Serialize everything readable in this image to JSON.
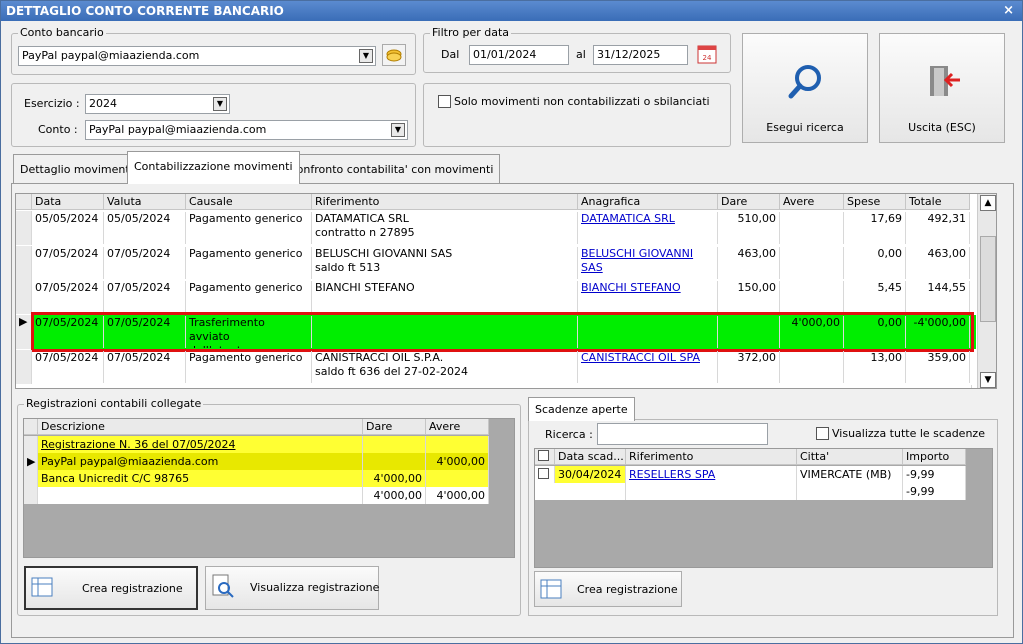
{
  "window": {
    "title": "DETTAGLIO CONTO CORRENTE BANCARIO",
    "close": "×"
  },
  "conto": {
    "label": "Conto bancario",
    "value": "PayPal paypal@miaazienda.com"
  },
  "esercizio": {
    "label": "Esercizio :",
    "value": "2024",
    "conto_label": "Conto :",
    "conto_value": "PayPal paypal@miaazienda.com"
  },
  "filtro": {
    "label": "Filtro per data",
    "dal_label": "Dal",
    "dal": "01/01/2024",
    "al_label": "al",
    "al": "31/12/2025",
    "calendar_num": "24"
  },
  "solo": {
    "label": "Solo movimenti non contabilizzati o sbilanciati"
  },
  "buttons": {
    "search": "Esegui ricerca",
    "exit": "Uscita (ESC)"
  },
  "tabs": [
    "Dettaglio movimenti",
    "Contabilizzazione movimenti",
    "Confronto contabilita' con movimenti"
  ],
  "movimenti": {
    "headers": [
      "Data",
      "Valuta",
      "Causale",
      "Riferimento",
      "Anagrafica",
      "Dare",
      "Avere",
      "Spese",
      "Totale"
    ],
    "rows": [
      [
        "05/05/2024",
        "05/05/2024",
        "Pagamento generico",
        "DATAMATICA SRL\ncontratto n 27895",
        "DATAMATICA SRL",
        "510,00",
        "",
        "17,69",
        "492,31"
      ],
      [
        "07/05/2024",
        "07/05/2024",
        "Pagamento generico",
        "BELUSCHI GIOVANNI SAS\nsaldo ft 513",
        "BELUSCHI GIOVANNI SAS",
        "463,00",
        "",
        "0,00",
        "463,00"
      ],
      [
        "07/05/2024",
        "07/05/2024",
        "Pagamento generico",
        "BIANCHI STEFANO",
        "BIANCHI STEFANO",
        "150,00",
        "",
        "5,45",
        "144,55"
      ],
      [
        "07/05/2024",
        "07/05/2024",
        "Trasferimento avviato\ndall'utente",
        "",
        "",
        "",
        "4'000,00",
        "0,00",
        "-4'000,00"
      ],
      [
        "07/05/2024",
        "07/05/2024",
        "Pagamento generico",
        "CANISTRACCI OIL S.P.A.\nsaldo ft 636 del 27-02-2024",
        "CANISTRACCI OIL SPA",
        "372,00",
        "",
        "13,00",
        "359,00"
      ]
    ]
  },
  "registrazioni": {
    "label": "Registrazioni contabili collegate",
    "headers": [
      "Descrizione",
      "Dare",
      "Avere"
    ],
    "rows": [
      [
        "Registrazione N. 36 del 07/05/2024",
        "",
        ""
      ],
      [
        "PayPal paypal@miaazienda.com",
        "",
        "4'000,00"
      ],
      [
        "Banca Unicredit C/C 98765",
        "4'000,00",
        ""
      ],
      [
        "",
        "4'000,00",
        "4'000,00"
      ]
    ],
    "btn_crea": "Crea registrazione",
    "btn_visualizza": "Visualizza registrazione"
  },
  "scadenze": {
    "tab": "Scadenze aperte",
    "ricerca_label": "Ricerca :",
    "ricerca_value": "",
    "tutte_label": "Visualizza tutte le scadenze",
    "headers": [
      "Data scad...",
      "Riferimento",
      "Citta'",
      "Importo"
    ],
    "rows": [
      [
        "30/04/2024",
        "RESELLERS SPA",
        "VIMERCATE (MB)",
        "-9,99"
      ],
      [
        "",
        "",
        "",
        "-9,99"
      ]
    ],
    "btn_crea": "Crea registrazione"
  },
  "colors": {
    "highlight_green": "#00ee00",
    "highlight_border": "#e01010",
    "yellow": "#ffff33",
    "link": "#0000cc"
  }
}
